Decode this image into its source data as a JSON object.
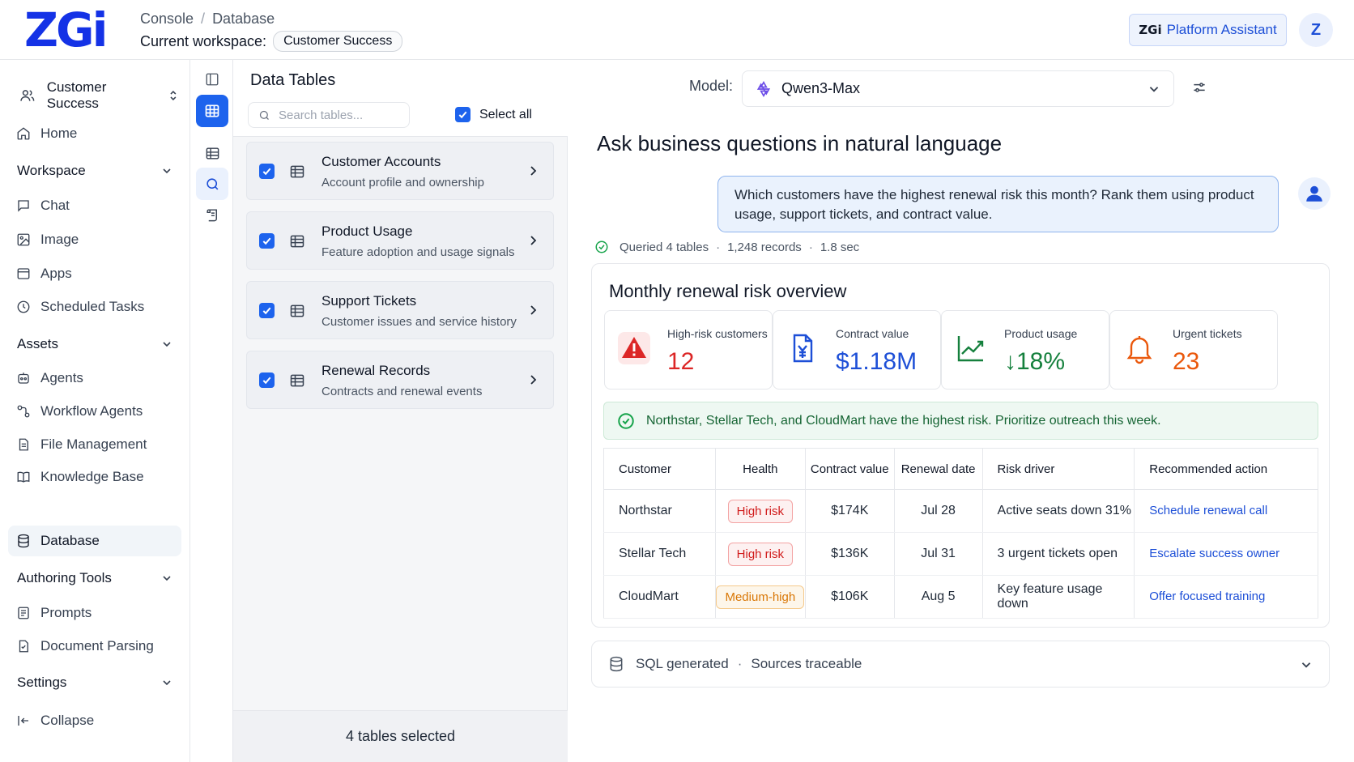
{
  "header": {
    "logo": "ZGi",
    "breadcrumb": [
      "Console",
      "Database"
    ],
    "workspace_label": "Current workspace:",
    "workspace_value": "Customer Success",
    "assistant_brand": "ZGi",
    "assistant_label": "Platform Assistant",
    "avatar_initial": "Z"
  },
  "sidebar": {
    "team": "Customer Success",
    "home": "Home",
    "sections": {
      "workspace": "Workspace",
      "assets": "Assets",
      "authoring": "Authoring Tools",
      "settings": "Settings"
    },
    "workspace_items": [
      "Chat",
      "Image",
      "Apps",
      "Scheduled Tasks"
    ],
    "asset_items": [
      "Agents",
      "Workflow Agents",
      "File Management",
      "Knowledge Base",
      "Database"
    ],
    "authoring_items": [
      "Prompts",
      "Document Parsing"
    ],
    "collapse": "Collapse",
    "active_item": "Database"
  },
  "tables_panel": {
    "title": "Data Tables",
    "search_placeholder": "Search tables...",
    "select_all": "Select all",
    "tables": [
      {
        "name": "Customer Accounts",
        "desc": "Account profile and ownership",
        "checked": true
      },
      {
        "name": "Product Usage",
        "desc": "Feature adoption and usage signals",
        "checked": true
      },
      {
        "name": "Support Tickets",
        "desc": "Customer issues and service history",
        "checked": true
      },
      {
        "name": "Renewal Records",
        "desc": "Contracts and renewal events",
        "checked": true
      }
    ],
    "footer": "4 tables selected"
  },
  "main": {
    "model_label": "Model:",
    "model_value": "Qwen3-Max",
    "title": "Ask business questions in natural language",
    "user_question": "Which customers have the highest renewal risk this month? Rank them using product usage, support tickets, and contract value.",
    "query_meta": {
      "tables": "Queried 4 tables",
      "records": "1,248 records",
      "time": "1.8 sec"
    },
    "result": {
      "title": "Monthly renewal risk overview",
      "stats": [
        {
          "label": "High-risk customers",
          "value": "12",
          "color": "#dc2626",
          "icon": "warning-icon"
        },
        {
          "label": "Contract value",
          "value": "$1.18M",
          "color": "#1d4fd7",
          "icon": "invoice-yen-icon"
        },
        {
          "label": "Product usage",
          "value": "↓18%",
          "color": "#15803d",
          "icon": "trend-chart-icon"
        },
        {
          "label": "Urgent tickets",
          "value": "23",
          "color": "#ea580c",
          "icon": "bell-icon"
        }
      ],
      "insight": "Northstar, Stellar Tech, and CloudMart have the highest risk. Prioritize outreach this week.",
      "columns": [
        "Customer",
        "Health",
        "Contract value",
        "Renewal date",
        "Risk driver",
        "Recommended action"
      ],
      "rows": [
        {
          "customer": "Northstar",
          "health": "High risk",
          "level": "high",
          "value": "$174K",
          "date": "Jul 28",
          "driver": "Active seats down 31%",
          "action": "Schedule renewal call"
        },
        {
          "customer": "Stellar Tech",
          "health": "High risk",
          "level": "high",
          "value": "$136K",
          "date": "Jul 31",
          "driver": "3 urgent tickets open",
          "action": "Escalate success owner"
        },
        {
          "customer": "CloudMart",
          "health": "Medium-high",
          "level": "med",
          "value": "$106K",
          "date": "Aug 5",
          "driver": "Key feature usage down",
          "action": "Offer focused training"
        }
      ]
    },
    "sql_bar": {
      "generated": "SQL generated",
      "sources": "Sources traceable"
    }
  },
  "colors": {
    "accent": "#1d63ed",
    "danger": "#dc2626",
    "success": "#16a34a",
    "warning": "#ea580c"
  }
}
